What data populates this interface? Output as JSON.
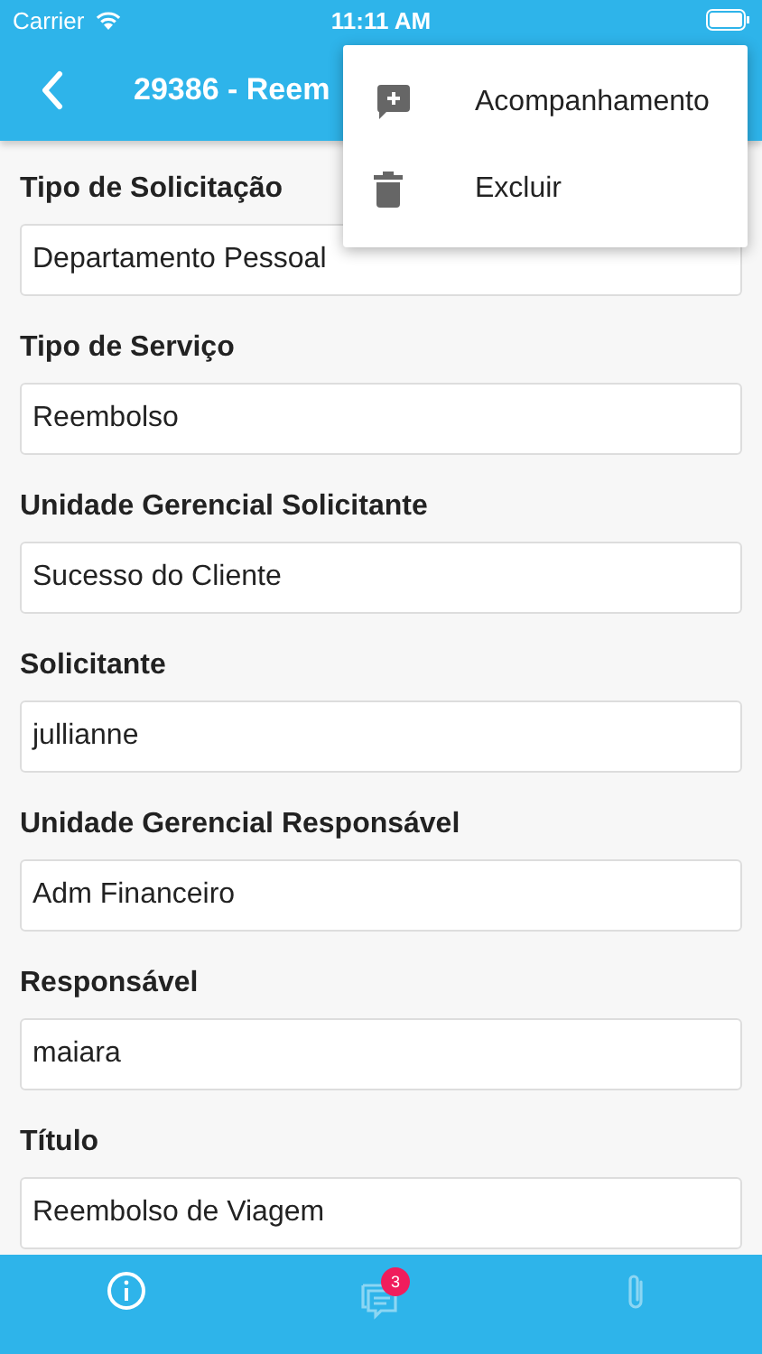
{
  "status_bar": {
    "carrier": "Carrier",
    "time": "11:11 AM"
  },
  "app_bar": {
    "title": "29386 - Reem"
  },
  "menu": [
    {
      "kind": "add-comment",
      "label": "Acompanhamento"
    },
    {
      "kind": "delete",
      "label": "Excluir"
    }
  ],
  "fields": [
    {
      "label": "Tipo de Solicitação",
      "value": "Departamento Pessoal"
    },
    {
      "label": "Tipo de Serviço",
      "value": "Reembolso"
    },
    {
      "label": "Unidade Gerencial Solicitante",
      "value": "Sucesso do Cliente"
    },
    {
      "label": "Solicitante",
      "value": "jullianne"
    },
    {
      "label": "Unidade Gerencial Responsável",
      "value": "Adm Financeiro"
    },
    {
      "label": "Responsável",
      "value": "maiara"
    },
    {
      "label": "Título",
      "value": "Reembolso de Viagem"
    }
  ],
  "tabs": [
    {
      "kind": "info",
      "selected": true
    },
    {
      "kind": "comments",
      "selected": false,
      "badge": "3"
    },
    {
      "kind": "attachment",
      "selected": false
    }
  ]
}
